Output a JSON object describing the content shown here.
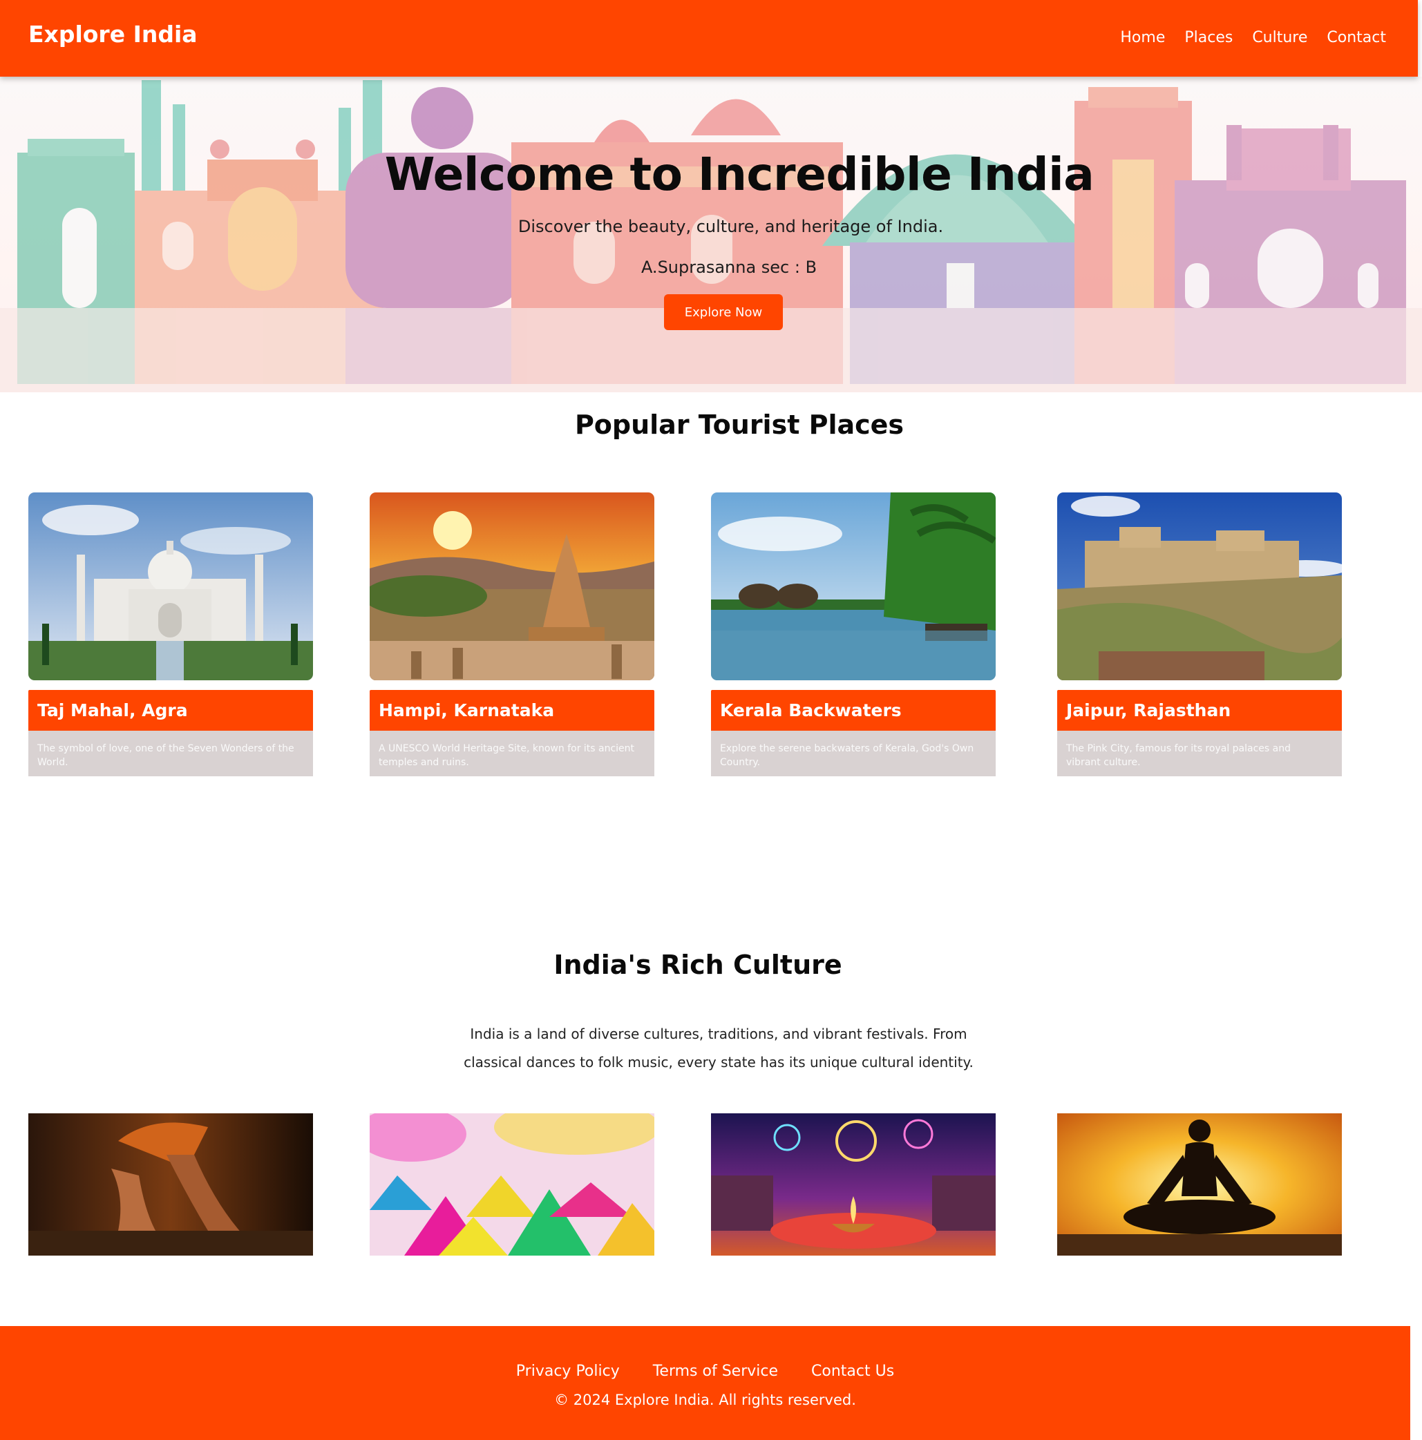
{
  "nav": {
    "brand": "Explore India",
    "links": [
      "Home",
      "Places",
      "Culture",
      "Contact"
    ]
  },
  "hero": {
    "title": "Welcome to Incredible India",
    "subtitle": "Discover the beauty, culture, and heritage of India.",
    "author": "A.Suprasanna sec : B",
    "button": "Explore Now"
  },
  "places": {
    "heading": "Popular Tourist Places",
    "cards": [
      {
        "title": "Taj Mahal, Agra",
        "desc": "The symbol of love, one of the Seven Wonders of the World.",
        "image": "taj-mahal-photo"
      },
      {
        "title": "Hampi, Karnataka",
        "desc": "A UNESCO World Heritage Site, known for its ancient temples and ruins.",
        "image": "hampi-temple-photo"
      },
      {
        "title": "Kerala Backwaters",
        "desc": "Explore the serene backwaters of Kerala, God's Own Country.",
        "image": "kerala-backwaters-photo"
      },
      {
        "title": "Jaipur, Rajasthan",
        "desc": "The Pink City, famous for its royal palaces and vibrant culture.",
        "image": "jaipur-fort-photo"
      }
    ]
  },
  "culture": {
    "heading": "India's Rich Culture",
    "text": "India is a land of diverse cultures, traditions, and vibrant festivals. From classical dances to folk music, every state has its unique cultural identity.",
    "images": [
      "classical-dance-photo",
      "holi-colors-photo",
      "diwali-festival-photo",
      "yoga-silhouette-photo"
    ]
  },
  "footer": {
    "links": [
      "Privacy Policy",
      "Terms of Service",
      "Contact Us"
    ],
    "copyright": "© 2024 Explore India. All rights reserved."
  },
  "colors": {
    "accent": "#ff4500",
    "card_desc_bg": "#d9d2d2"
  }
}
